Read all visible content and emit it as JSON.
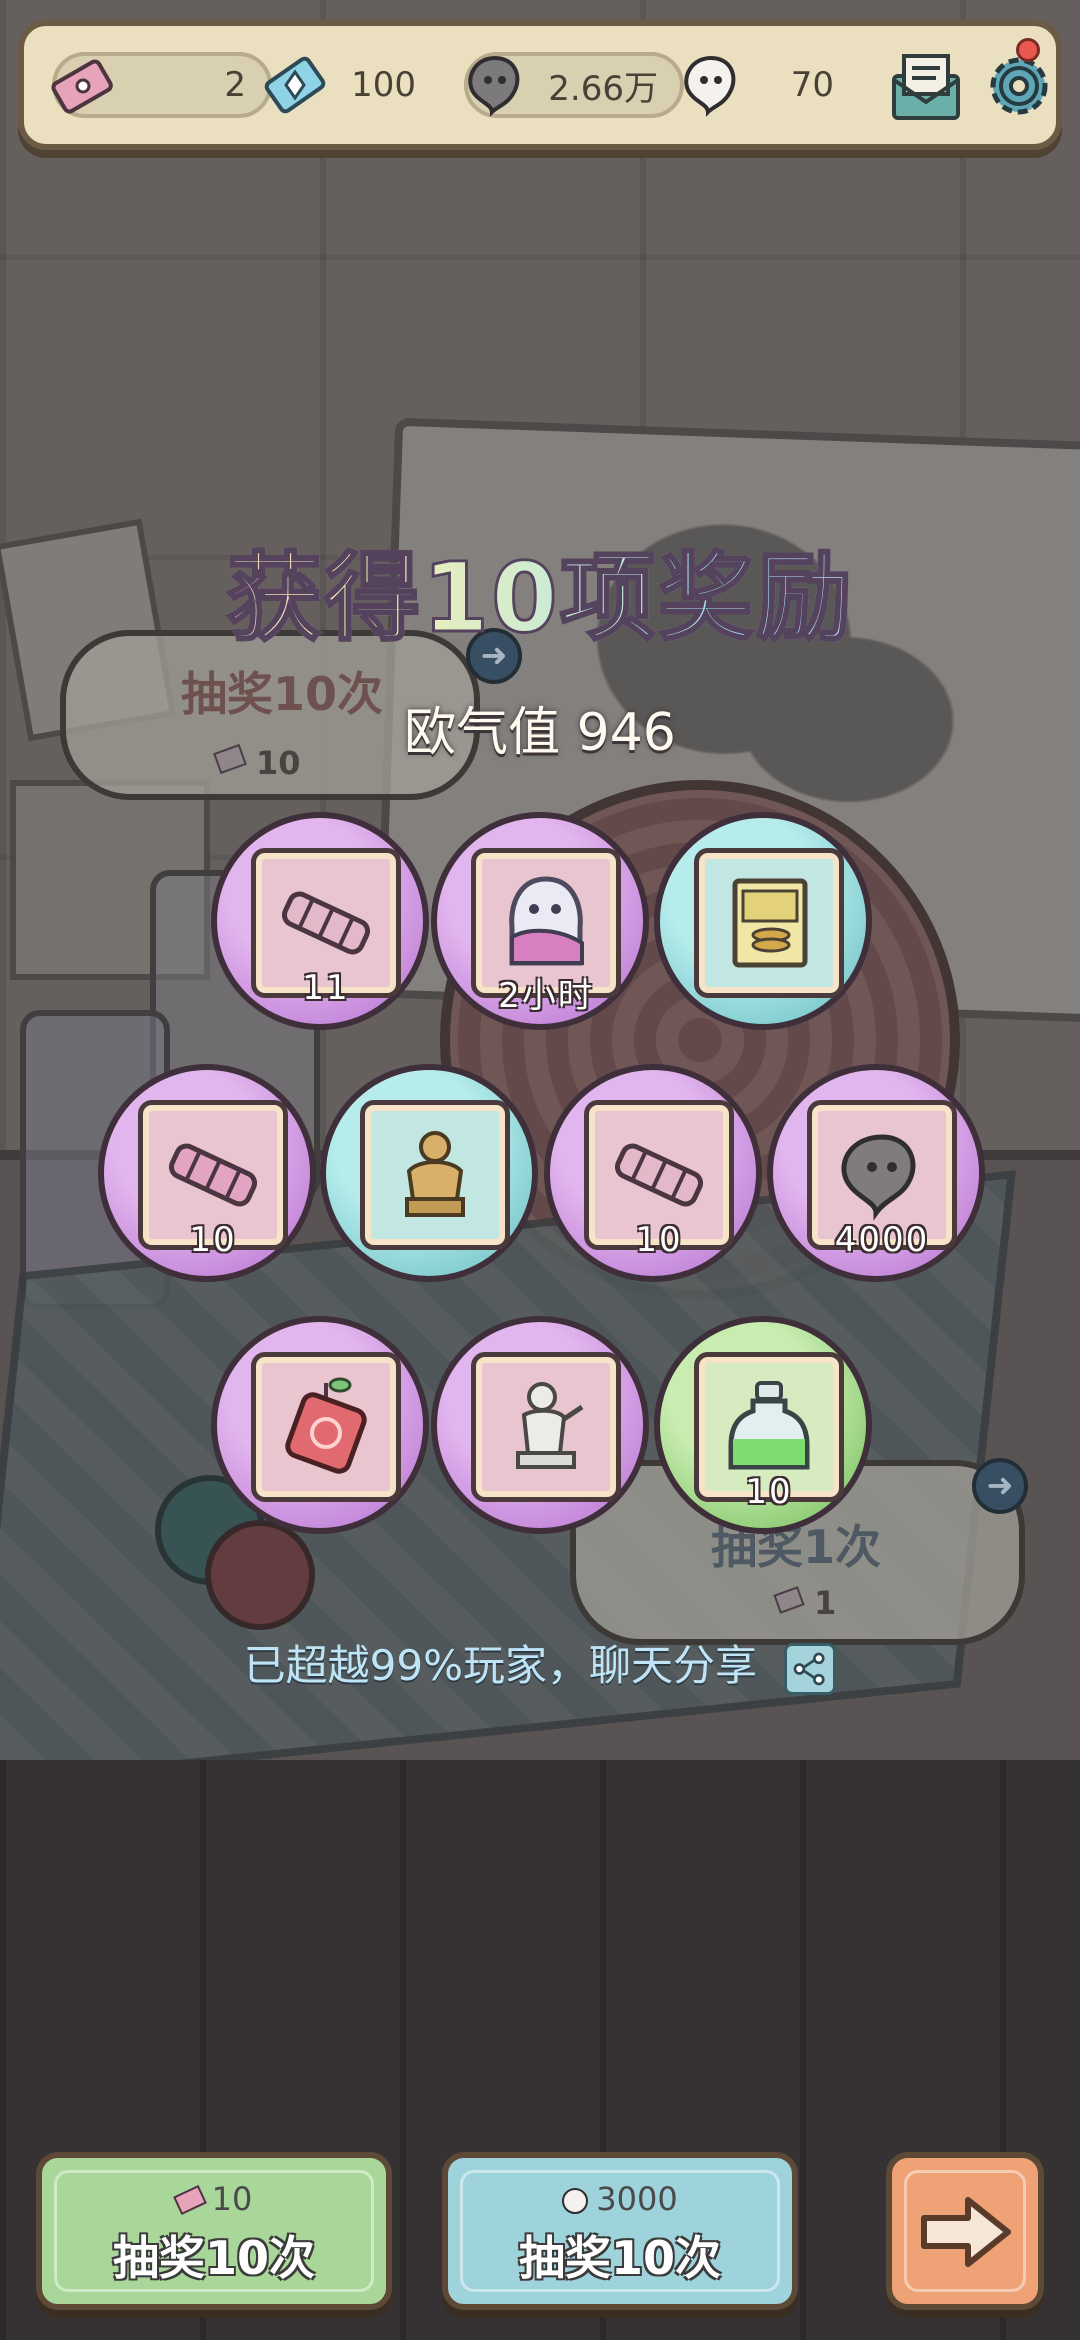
{
  "resources": {
    "ticket_count": "2",
    "diamond_count": "100",
    "soul_count": "2.66万",
    "ghost_count": "70"
  },
  "background": {
    "draw10_label": "抽奖10次",
    "draw10_cost": "10",
    "draw1_label": "抽奖1次",
    "draw1_cost": "1"
  },
  "reward_panel": {
    "title": "获得10项奖励",
    "luck_value": "欧气值 946",
    "rewards": [
      {
        "item": "scroll",
        "qty": "11"
      },
      {
        "item": "ghost-cloak",
        "qty": "2小时"
      },
      {
        "item": "coin-book",
        "qty": ""
      },
      {
        "item": "scroll",
        "qty": "10"
      },
      {
        "item": "golden-statue",
        "qty": ""
      },
      {
        "item": "scroll",
        "qty": "10"
      },
      {
        "item": "soul-orb",
        "qty": "4000"
      },
      {
        "item": "red-charm",
        "qty": ""
      },
      {
        "item": "white-statue",
        "qty": ""
      },
      {
        "item": "green-potion",
        "qty": "10"
      }
    ],
    "share_text": "已超越99%玩家，聊天分享"
  },
  "bottom": {
    "ticket_button": {
      "cost": "10",
      "label": "抽奖10次",
      "color": "#a9d79a"
    },
    "soul_button": {
      "cost": "3000",
      "label": "抽奖10次",
      "color": "#9fd3dc"
    },
    "next_button": {
      "color": "#f0a277"
    }
  }
}
